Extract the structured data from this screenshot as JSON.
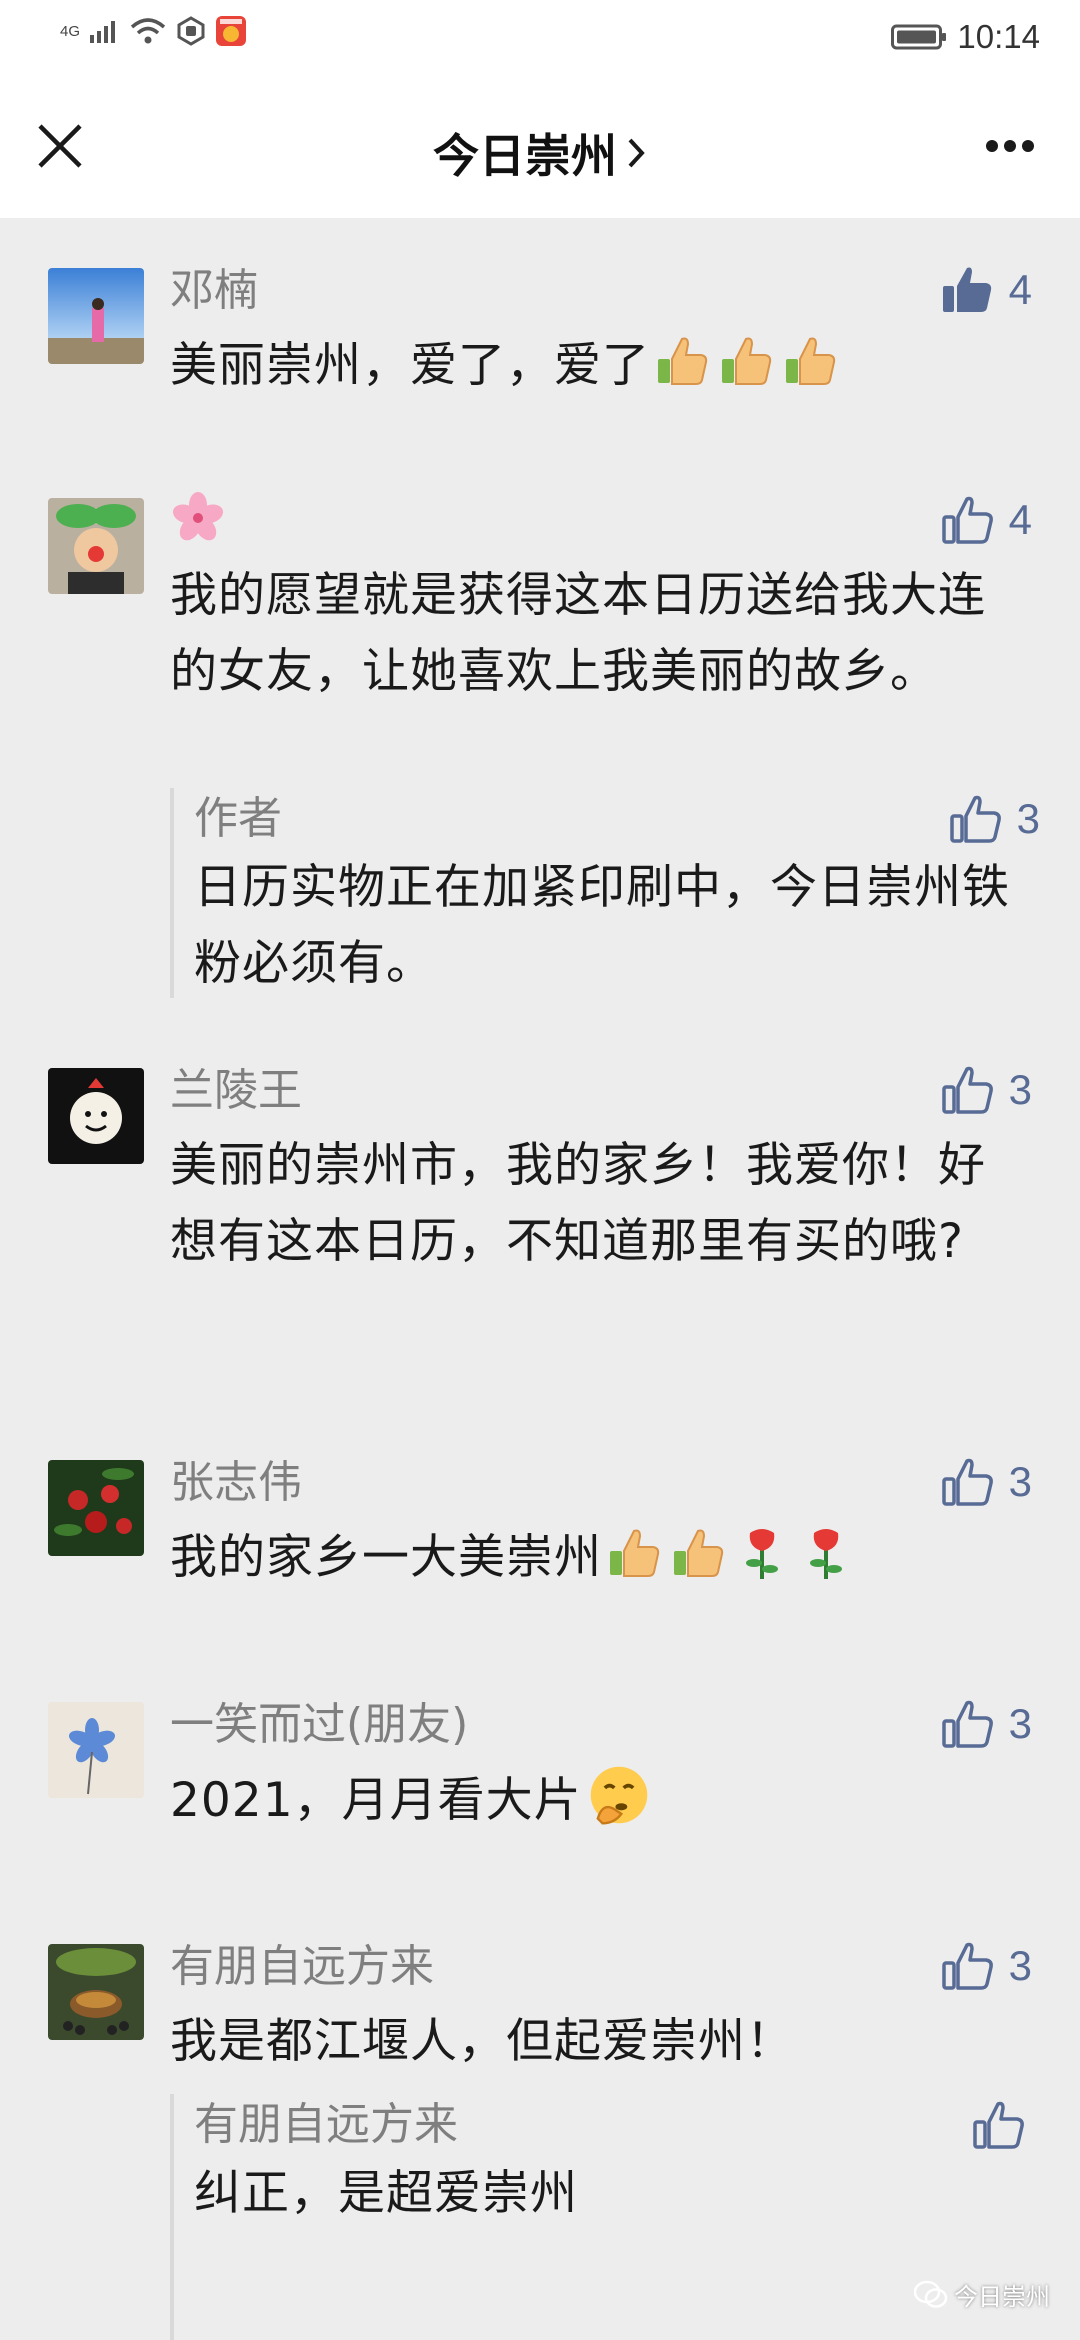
{
  "status_bar": {
    "network": "4G",
    "time": "10:14"
  },
  "nav": {
    "title": "今日崇州",
    "chevron": "›",
    "close_icon": "close-icon",
    "more_icon": "more-icon"
  },
  "colors": {
    "like_count": "#576b95",
    "like_filled": "#576b95",
    "name": "#7f7f7f",
    "background": "#ededed"
  },
  "comments": [
    {
      "name": "邓楠",
      "text": "美丽崇州，爱了，爱了",
      "likes": "4",
      "liked": true,
      "emoji": [
        "thumbs-up",
        "thumbs-up",
        "thumbs-up"
      ]
    },
    {
      "name": "",
      "name_emoji": "cherry-blossom",
      "text": "我的愿望就是获得这本日历送给我大连的女友，让她喜欢上我美丽的故乡。",
      "likes": "4",
      "liked": false,
      "reply": {
        "name": "作者",
        "text": "日历实物正在加紧印刷中，今日崇州铁粉必须有。",
        "likes": "3"
      }
    },
    {
      "name": "兰陵王",
      "text": "美丽的崇州市，我的家乡！我爱你！好想有这本日历，不知道那里有买的哦?",
      "likes": "3",
      "liked": false
    },
    {
      "name": "张志伟",
      "text": "我的家乡一大美崇州",
      "likes": "3",
      "liked": false,
      "emoji": [
        "thumbs-up",
        "thumbs-up",
        "rose",
        "rose"
      ]
    },
    {
      "name": "一笑而过(朋友)",
      "text": "2021，月月看大片",
      "likes": "3",
      "liked": false,
      "emoji": [
        "shushing-face"
      ]
    },
    {
      "name": "有朋自远方来",
      "text": "我是都江堰人，但起爱崇州！",
      "likes": "3",
      "liked": false,
      "reply": {
        "name": "有朋自远方来",
        "text": "纠正，是超爱崇州",
        "likes": ""
      }
    }
  ],
  "watermark": "今日崇州"
}
